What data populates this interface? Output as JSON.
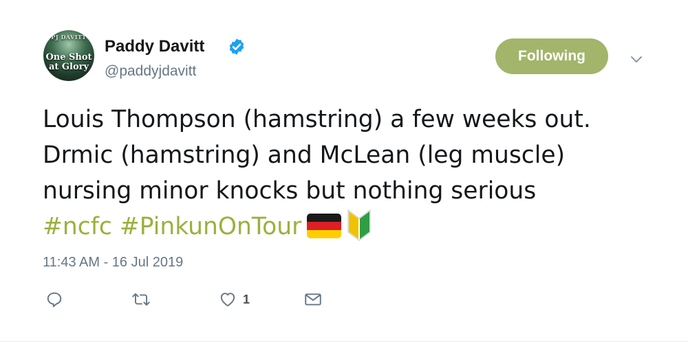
{
  "user": {
    "display_name": "Paddy Davitt",
    "handle": "@paddyjdavitt",
    "verified": true,
    "avatar_text": {
      "top": "PJ DAVITT",
      "line1": "One Shot",
      "line2": "at Glory"
    }
  },
  "follow_button": {
    "label": "Following",
    "color": "#a2b56b"
  },
  "tweet": {
    "lines": [
      "Louis Thompson (hamstring) a few weeks out.",
      "Drmic (hamstring) and McLean (leg muscle)",
      "nursing minor knocks but nothing serious"
    ],
    "hashtags": [
      "#ncfc",
      "#PinkunOnTour"
    ],
    "emojis": [
      "germany-flag",
      "japanese-beginner-symbol"
    ],
    "hashtag_color": "#9ab13c"
  },
  "timestamp": "11:43 AM - 16 Jul 2019",
  "actions": {
    "reply_icon": "reply-icon",
    "retweet_icon": "retweet-icon",
    "like_icon": "heart-icon",
    "like_count": "1",
    "dm_icon": "envelope-icon"
  }
}
